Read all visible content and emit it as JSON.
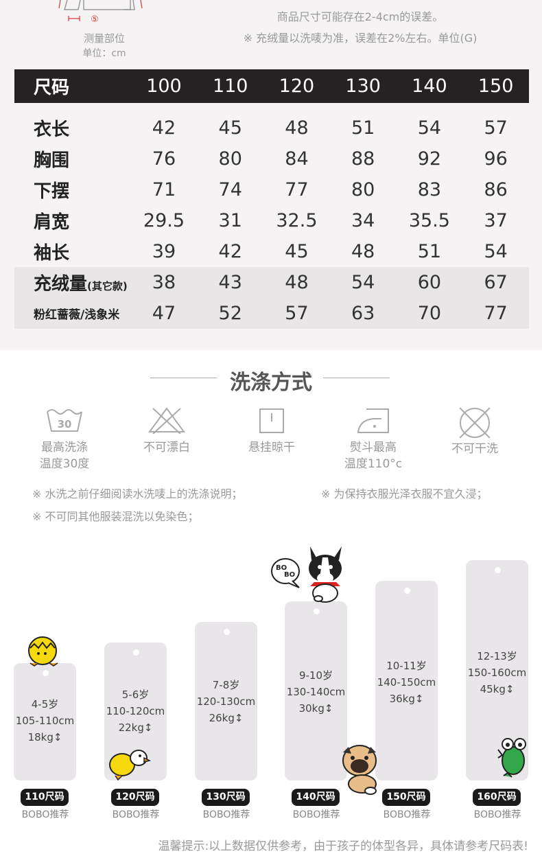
{
  "top": {
    "diagram_marker": "⑤",
    "measure_label": "测量部位",
    "unit_label": "单位：cm",
    "notes": [
      "商品尺寸可能存在2-4cm的误差。",
      "※ 充绒量以洗唛为准，误差在2%左右。单位(G)"
    ]
  },
  "size_table": {
    "header": {
      "label": "尺码",
      "values": [
        "100",
        "110",
        "120",
        "130",
        "140",
        "150"
      ]
    },
    "rows": [
      {
        "label": "衣长",
        "values": [
          "42",
          "45",
          "48",
          "51",
          "54",
          "57"
        ]
      },
      {
        "label": "胸围",
        "values": [
          "76",
          "80",
          "84",
          "88",
          "92",
          "96"
        ]
      },
      {
        "label": "下摆",
        "values": [
          "71",
          "74",
          "77",
          "80",
          "83",
          "86"
        ]
      },
      {
        "label": "肩宽",
        "values": [
          "29.5",
          "31",
          "32.5",
          "34",
          "35.5",
          "37"
        ]
      },
      {
        "label": "袖长",
        "values": [
          "39",
          "42",
          "45",
          "48",
          "51",
          "54"
        ]
      },
      {
        "label": "充绒量",
        "suffix": "(其它款)",
        "values": [
          "38",
          "43",
          "48",
          "54",
          "60",
          "67"
        ]
      },
      {
        "label": "粉红蔷薇/浅象米",
        "values": [
          "47",
          "52",
          "57",
          "63",
          "70",
          "77"
        ]
      }
    ]
  },
  "wash": {
    "title": "洗涤方式",
    "items": [
      {
        "icon": "wash-30-icon",
        "num": "30",
        "caption": [
          "最高洗涤",
          "温度30度"
        ]
      },
      {
        "icon": "no-bleach-icon",
        "caption": [
          "不可漂白"
        ]
      },
      {
        "icon": "hang-dry-icon",
        "caption": [
          "悬挂晾干"
        ]
      },
      {
        "icon": "iron-icon",
        "caption": [
          "熨斗最高",
          "温度110°c"
        ]
      },
      {
        "icon": "no-dry-clean-icon",
        "caption": [
          "不可干洗"
        ]
      }
    ],
    "notes": [
      "※ 水洗之前仔细阅读水洗唛上的洗涤说明；",
      "※ 为保持衣服光泽衣服不宜久浸；",
      "※ 不可同其他服装混洗以免染色；"
    ]
  },
  "tags": [
    {
      "age": "4-5岁",
      "height": "105-110cm",
      "weight": "18kg↕",
      "badge": "110尺码",
      "rec": "BOBO推荐"
    },
    {
      "age": "5-6岁",
      "height": "110-120cm",
      "weight": "22kg↕",
      "badge": "120尺码",
      "rec": "BOBO推荐"
    },
    {
      "age": "7-8岁",
      "height": "120-130cm",
      "weight": "26kg↕",
      "badge": "130尺码",
      "rec": "BOBO推荐"
    },
    {
      "age": "9-10岁",
      "height": "130-140cm",
      "weight": "30kg↕",
      "badge": "140尺码",
      "rec": "BOBO推荐"
    },
    {
      "age": "10-11岁",
      "height": "140-150cm",
      "weight": "36kg↕",
      "badge": "150尺码",
      "rec": "BOBO推荐"
    },
    {
      "age": "12-13岁",
      "height": "150-160cm",
      "weight": "45kg↕",
      "badge": "160尺码",
      "rec": "BOBO推荐"
    }
  ],
  "mascot_bubble": [
    "BO",
    "BO"
  ],
  "footer": "温馨提示:以上数据仅供参考，由于孩子的体型各异，具体请参考尺码表!"
}
